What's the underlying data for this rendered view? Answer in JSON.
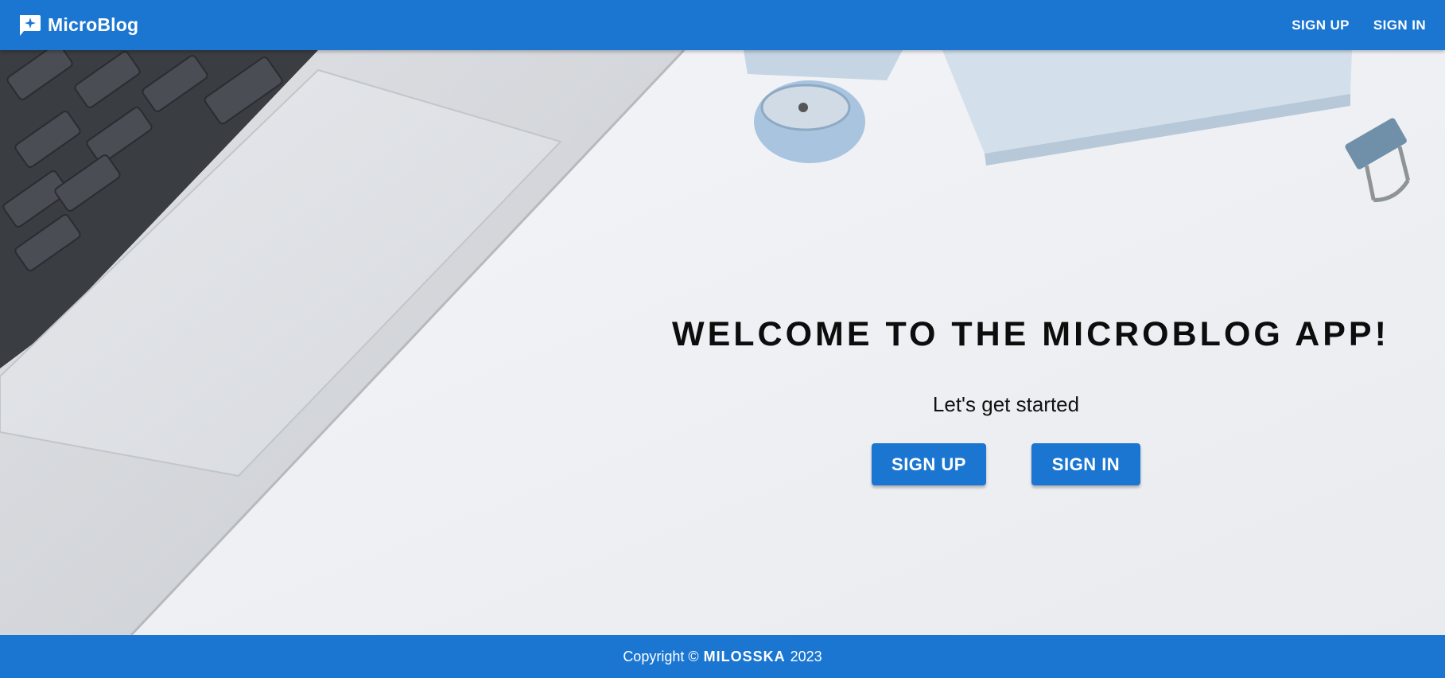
{
  "navbar": {
    "brand_icon": "chat-sparkle-icon",
    "brand_name": "MicroBlog",
    "links": [
      {
        "label": "SIGN UP"
      },
      {
        "label": "SIGN IN"
      }
    ]
  },
  "hero": {
    "background_image": "laptop-desk-photo",
    "heading": "WELCOME TO THE MICROBLOG APP!",
    "subtitle": "Let's get started",
    "buttons": {
      "signup_label": "SIGN UP",
      "signin_label": "SIGN IN"
    }
  },
  "footer": {
    "prefix": "Copyright ©",
    "author": "MILOSSKA",
    "year": "2023"
  },
  "colors": {
    "primary": "#1b76d2",
    "background": "#eef0f3",
    "text_dark": "#0d0d0d"
  }
}
